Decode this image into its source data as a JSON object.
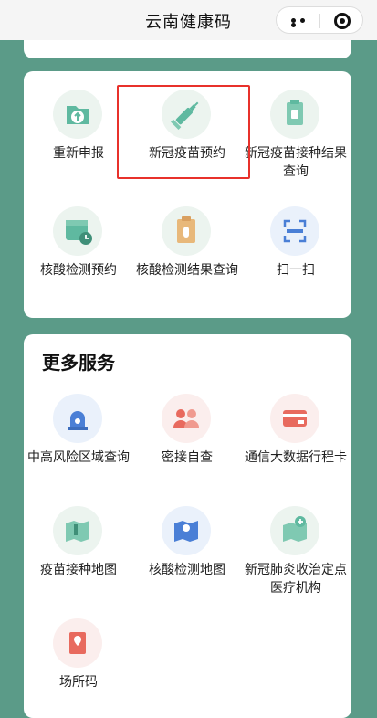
{
  "app": {
    "title": "云南健康码"
  },
  "main_section": {
    "items": [
      {
        "label": "重新申报"
      },
      {
        "label": "新冠疫苗预约"
      },
      {
        "label": "新冠疫苗接种结果查询"
      },
      {
        "label": "核酸检测预约"
      },
      {
        "label": "核酸检测结果查询"
      },
      {
        "label": "扫一扫"
      }
    ]
  },
  "more_services": {
    "title": "更多服务",
    "items": [
      {
        "label": "中高风险区域查询"
      },
      {
        "label": "密接自查"
      },
      {
        "label": "通信大数据行程卡"
      },
      {
        "label": "疫苗接种地图"
      },
      {
        "label": "核酸检测地图"
      },
      {
        "label": "新冠肺炎收治定点医疗机构"
      },
      {
        "label": "场所码"
      }
    ]
  },
  "colors": {
    "background": "#5b9b88",
    "highlight": "#e8312b",
    "icon_teal": "#5fb9a0"
  }
}
